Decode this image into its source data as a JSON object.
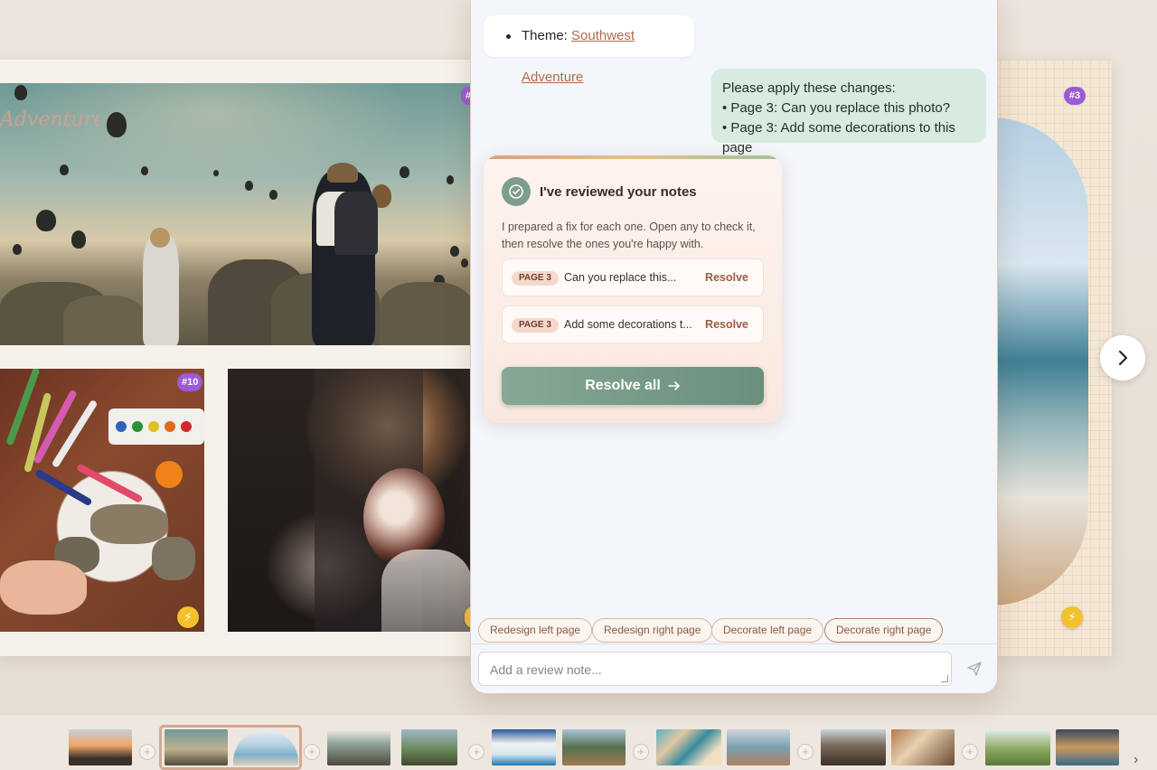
{
  "chat": {
    "theme_label": "Theme:",
    "theme_value": "Southwest Adventure",
    "user_message": {
      "intro": "Please apply these changes:",
      "items": [
        "• Page 3: Can you replace this photo?",
        "• Page 3: Add some decorations to this page"
      ]
    },
    "review": {
      "title": "I've reviewed your notes",
      "body": "I prepared a fix for each one. Open any to check it, then resolve the ones you're happy with.",
      "notes": [
        {
          "tag": "PAGE 3",
          "text": "Can you replace this...",
          "action": "Resolve"
        },
        {
          "tag": "PAGE 3",
          "text": "Add some decorations t...",
          "action": "Resolve"
        }
      ],
      "resolve_all_label": "Resolve all"
    },
    "suggestions": [
      "Redesign left page",
      "Redesign right page",
      "Decorate left page",
      "Decorate right page"
    ],
    "composer_placeholder": "Add a review note..."
  },
  "book": {
    "photo_badges": {
      "balloons": "#",
      "crafts": "#10",
      "beach": "#3"
    },
    "script_title": "Adventure"
  },
  "colors": {
    "accent_brown": "#b06a4c",
    "accent_sage": "#7d9e8d",
    "user_bubble": "#d7ebe0",
    "badge_purple": "#9b5ad6",
    "bolt_yellow": "#f3c12c"
  },
  "icons": [
    "check-circle-icon",
    "arrow-right-icon",
    "send-icon",
    "chevron-right-icon",
    "bolt-icon",
    "plus-icon"
  ]
}
